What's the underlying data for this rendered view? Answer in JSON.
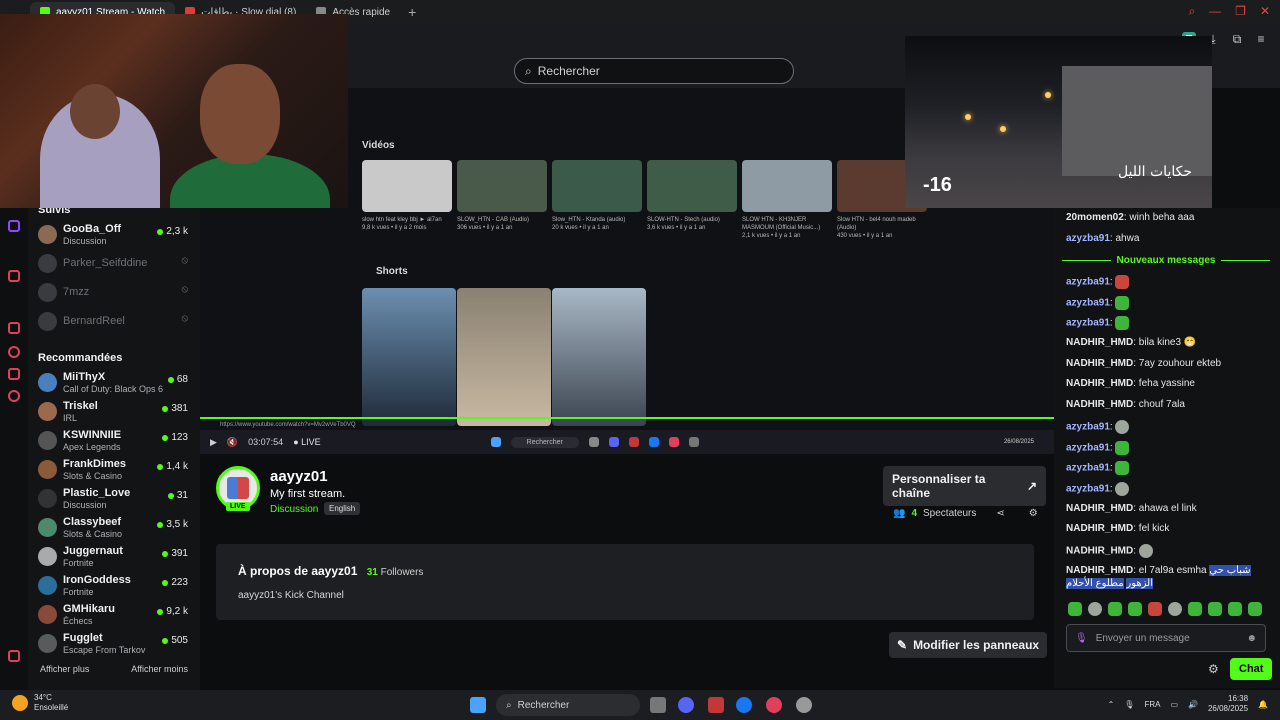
{
  "browser": {
    "tabs": [
      {
        "label": "aayyz01 Stream - Watch",
        "color": "#53fc18"
      },
      {
        "label": "بطاقات · Slow djal (8)",
        "color": "#e03b3b"
      },
      {
        "label": "Accès rapide",
        "color": "#888888"
      }
    ]
  },
  "header": {
    "search_placeholder": "Rechercher",
    "avatar_letter": "T"
  },
  "overlay": {
    "counter": "-16",
    "watermark": "حكايات الليل"
  },
  "sidebar": {
    "followed_title": "Suivis",
    "followed": [
      {
        "name": "GooBa_Off",
        "sub": "Discussion",
        "viewers": "2,3 k",
        "online": true
      },
      {
        "name": "Parker_Seifddine",
        "sub": "",
        "viewers": "",
        "online": false
      },
      {
        "name": "7mzz",
        "sub": "",
        "viewers": "",
        "online": false
      },
      {
        "name": "BernardReel",
        "sub": "",
        "viewers": "",
        "online": false
      }
    ],
    "recommended_title": "Recommandées",
    "recommended": [
      {
        "name": "MiiThyX",
        "sub": "Call of Duty: Black Ops 6",
        "viewers": "68"
      },
      {
        "name": "Triskel",
        "sub": "IRL",
        "viewers": "381"
      },
      {
        "name": "KSWINNIIE",
        "sub": "Apex Legends",
        "viewers": "123"
      },
      {
        "name": "FrankDimes",
        "sub": "Slots & Casino",
        "viewers": "1,4 k"
      },
      {
        "name": "Plastic_Love",
        "sub": "Discussion",
        "viewers": "31"
      },
      {
        "name": "Classybeef",
        "sub": "Slots & Casino",
        "viewers": "3,5 k"
      },
      {
        "name": "Juggernaut",
        "sub": "Fortnite",
        "viewers": "391"
      },
      {
        "name": "IronGoddess",
        "sub": "Fortnite",
        "viewers": "223"
      },
      {
        "name": "GMHikaru",
        "sub": "Échecs",
        "viewers": "9,2 k"
      },
      {
        "name": "Fugglet",
        "sub": "Escape From Tarkov",
        "viewers": "505"
      }
    ],
    "show_more": "Afficher plus",
    "show_less": "Afficher moins"
  },
  "stream": {
    "videos_title": "Vidéos",
    "shorts_title": "Shorts",
    "videos": [
      {
        "title": "slow htn feat kley bbj ► al7an",
        "meta": "9,8 k vues • il y a 2 mois",
        "color": "#c9c9c9"
      },
      {
        "title": "SLOW_HTN - CAB (Audio)",
        "meta": "306 vues • il y a 1 an",
        "color": "#4a5a4a"
      },
      {
        "title": "Slow_HTN - Ktanda (audio)",
        "meta": "20 k vues • il y a 1 an",
        "color": "#3b5a4a"
      },
      {
        "title": "SLOW-HTN - Stech (audio)",
        "meta": "3,6 k vues • il y a 1 an",
        "color": "#3e5c48"
      },
      {
        "title": "SLOW HTN - KH3NJER MASMOUM (Official Music...)",
        "meta": "2,1 k vues • il y a 1 an",
        "color": "#8e9aa4"
      },
      {
        "title": "Slow HTN - bel4 nouh madeb (Audio)",
        "meta": "430 vues • il y a 1 an",
        "color": "#5b3a30"
      }
    ],
    "url_text": "https://www.youtube.com/watch?v=Mv2wVeTb0VQ",
    "timer": "03:07:54",
    "live_label": "LIVE",
    "mini_search": "Rechercher",
    "mini_date": "26/08/2025"
  },
  "channel": {
    "name": "aayyz01",
    "title": "My first stream.",
    "category": "Discussion",
    "language": "English",
    "live_badge": "LIVE",
    "customize_label": "Personnaliser ta chaîne",
    "viewers_count": "4",
    "viewers_label": "Spectateurs",
    "about_title": "À propos de aayyz01",
    "followers_count": "31",
    "followers_label": "Followers",
    "about_desc": "aayyz01's Kick Channel",
    "edit_panels_label": "Modifier les panneaux"
  },
  "chat": {
    "new_messages_label": "Nouveaux messages",
    "messages": [
      {
        "user": "20momen02",
        "text": "winh beha aaa",
        "emote": "",
        "color": "white"
      },
      {
        "user": "azyzba91",
        "text": "ahwa",
        "emote": "",
        "color": "blue"
      },
      {
        "user": "azyzba91",
        "text": "",
        "emote": "red",
        "color": "blue"
      },
      {
        "user": "azyzba91",
        "text": "",
        "emote": "green",
        "color": "blue"
      },
      {
        "user": "azyzba91",
        "text": "",
        "emote": "green",
        "color": "blue"
      },
      {
        "user": "NADHIR_HMD",
        "text": "bila kine3 😁",
        "emote": "",
        "color": "white"
      },
      {
        "user": "NADHIR_HMD",
        "text": "7ay zouhour ekteb",
        "emote": "",
        "color": "white"
      },
      {
        "user": "NADHIR_HMD",
        "text": "feha yassine",
        "emote": "",
        "color": "white"
      },
      {
        "user": "NADHIR_HMD",
        "text": "chouf 7ala",
        "emote": "",
        "color": "white"
      },
      {
        "user": "azyzba91",
        "text": "",
        "emote": "skull",
        "color": "blue"
      },
      {
        "user": "azyzba91",
        "text": "",
        "emote": "green",
        "color": "blue"
      },
      {
        "user": "azyzba91",
        "text": "",
        "emote": "green",
        "color": "blue"
      },
      {
        "user": "azyzba91",
        "text": "",
        "emote": "skull",
        "color": "blue"
      },
      {
        "user": "NADHIR_HMD",
        "text": "ahawa el link",
        "emote": "",
        "color": "white"
      },
      {
        "user": "NADHIR_HMD",
        "text": "fel kick",
        "emote": "",
        "color": "white"
      },
      {
        "user": "NADHIR_HMD",
        "text": "",
        "emote": "skull",
        "color": "white"
      }
    ],
    "last_message": {
      "user": "NADHIR_HMD",
      "text": "el 7al9a esmha",
      "highlight1": "شباب حي الزهور",
      "highlight2": "مطلوع الأحلام"
    },
    "input_placeholder": "Envoyer un message",
    "send_label": "Chat"
  },
  "taskbar": {
    "temperature": "34°C",
    "weather": "Ensoleillé",
    "search": "Rechercher",
    "lang": "FRA",
    "time": "16:38",
    "date": "26/08/2025"
  }
}
